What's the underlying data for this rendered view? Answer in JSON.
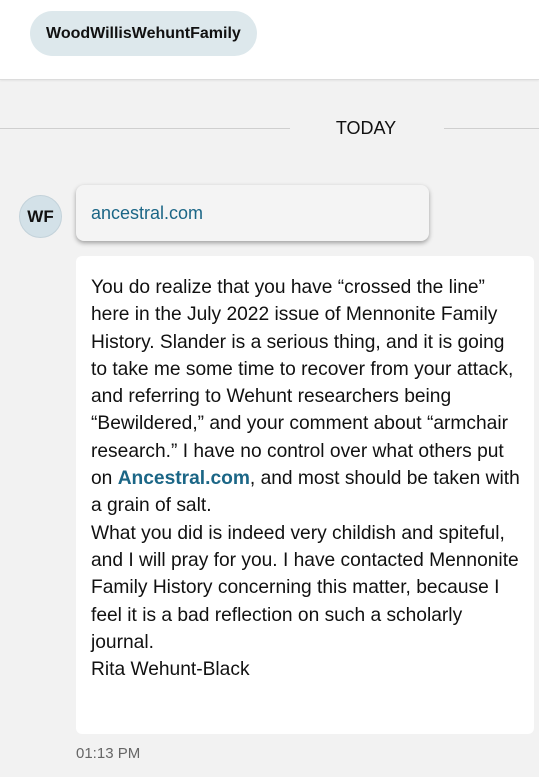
{
  "header": {
    "chip_label": "WoodWillisWehuntFamily"
  },
  "divider": {
    "label": "TODAY"
  },
  "message": {
    "avatar_initials": "WF",
    "link_text": "ancestral.com",
    "body": {
      "para1_before_link": "You do realize that you have “crossed the line” here in the July 2022 issue of Mennonite Family History. Slander is a serious thing, and it is going to take me some time to recover from your attack, and referring to Wehunt researchers being “Bewildered,” and your comment about “armchair research.” I have no control over what others put on ",
      "para1_link": "Ancestral.com",
      "para1_after_link": ", and most should be taken with a grain of salt.",
      "para2": "What you did is indeed very childish and spiteful, and I will pray for you. I have contacted Mennonite Family History concerning this matter, because I feel it is a bad reflection on such a scholarly journal.",
      "signature": "Rita Wehunt-Black"
    },
    "timestamp": "01:13 PM"
  },
  "colors": {
    "background": "#f2f2f2",
    "chip_bg": "#dde8ec",
    "avatar_bg": "#d3e1e8",
    "link": "#1b6686",
    "timestamp": "#666666"
  }
}
